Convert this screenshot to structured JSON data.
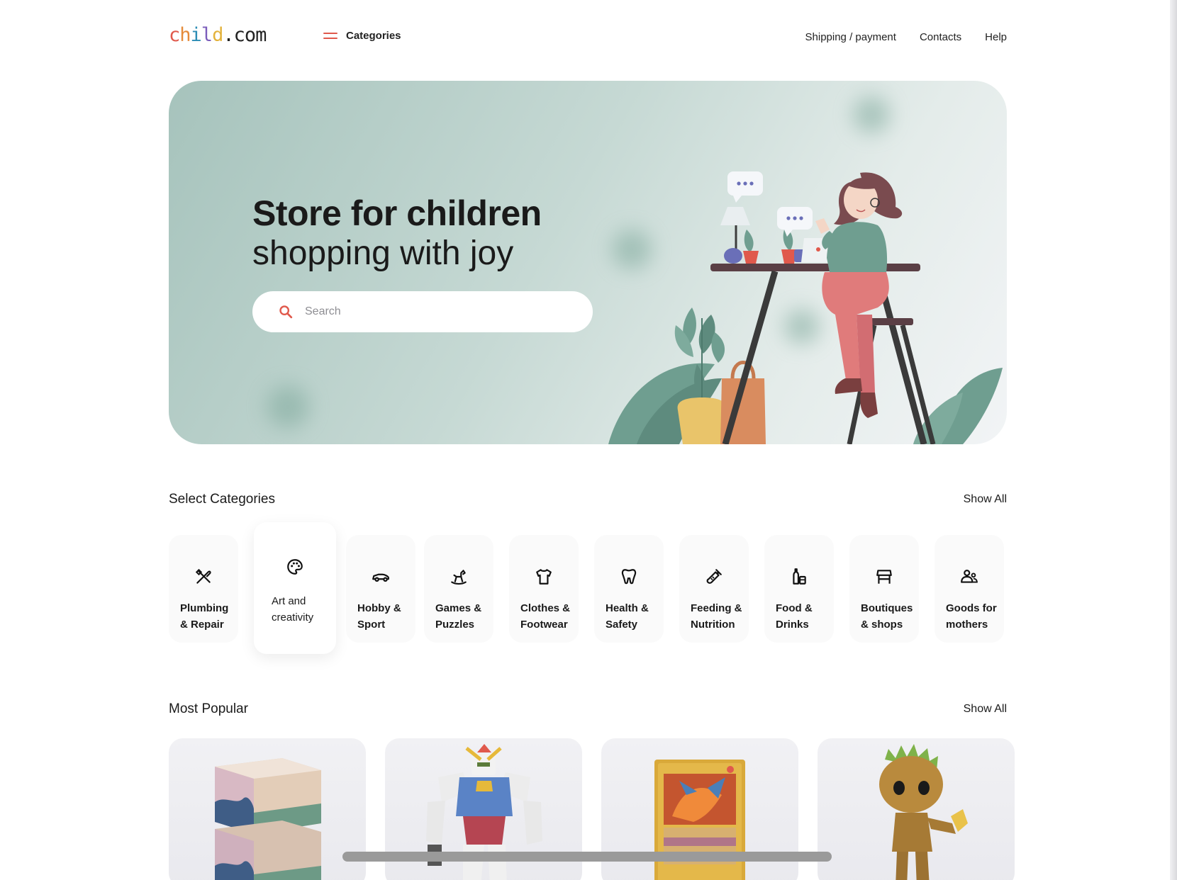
{
  "header": {
    "logo": {
      "c1": "c",
      "c2": "h",
      "c3": "i",
      "c4": "l",
      "c5": "d",
      "rest": ".com"
    },
    "categories_label": "Categories",
    "nav": [
      {
        "label": "Shipping / payment"
      },
      {
        "label": "Contacts"
      },
      {
        "label": "Help"
      }
    ]
  },
  "hero": {
    "title": "Store for children",
    "subtitle": "shopping with joy",
    "search_placeholder": "Search"
  },
  "categories_section": {
    "title": "Select Categories",
    "show_all": "Show All",
    "items": [
      {
        "line1": "Plumbing",
        "line2": "& Repair",
        "icon": "tools-icon"
      },
      {
        "line1": "Art and",
        "line2": "creativity",
        "icon": "palette-icon",
        "active": true
      },
      {
        "line1": "Hobby &",
        "line2": "Sport",
        "icon": "race-car-icon"
      },
      {
        "line1": "Games &",
        "line2": "Puzzles",
        "icon": "rocking-horse-icon"
      },
      {
        "line1": "Clothes &",
        "line2": "Footwear",
        "icon": "shirt-icon"
      },
      {
        "line1": "Health &",
        "line2": "Safety",
        "icon": "tooth-icon"
      },
      {
        "line1": "Feeding &",
        "line2": "Nutrition",
        "icon": "baby-bottle-icon"
      },
      {
        "line1": "Food &",
        "line2": "Drinks",
        "icon": "bottles-icon"
      },
      {
        "line1": "Boutiques",
        "line2": "& shops",
        "icon": "store-icon"
      },
      {
        "line1": "Goods for",
        "line2": "mothers",
        "icon": "mother-child-icon"
      }
    ]
  },
  "popular_section": {
    "title": "Most Popular",
    "show_all": "Show All",
    "products": [
      {
        "image": "boxed-product-image"
      },
      {
        "image": "robot-figure-image"
      },
      {
        "image": "trading-card-image"
      },
      {
        "image": "groot-figure-image"
      }
    ]
  },
  "colors": {
    "accent": "#e0594c",
    "hero_teal": "#a6c3bc",
    "plant_green": "#6f9e90"
  }
}
